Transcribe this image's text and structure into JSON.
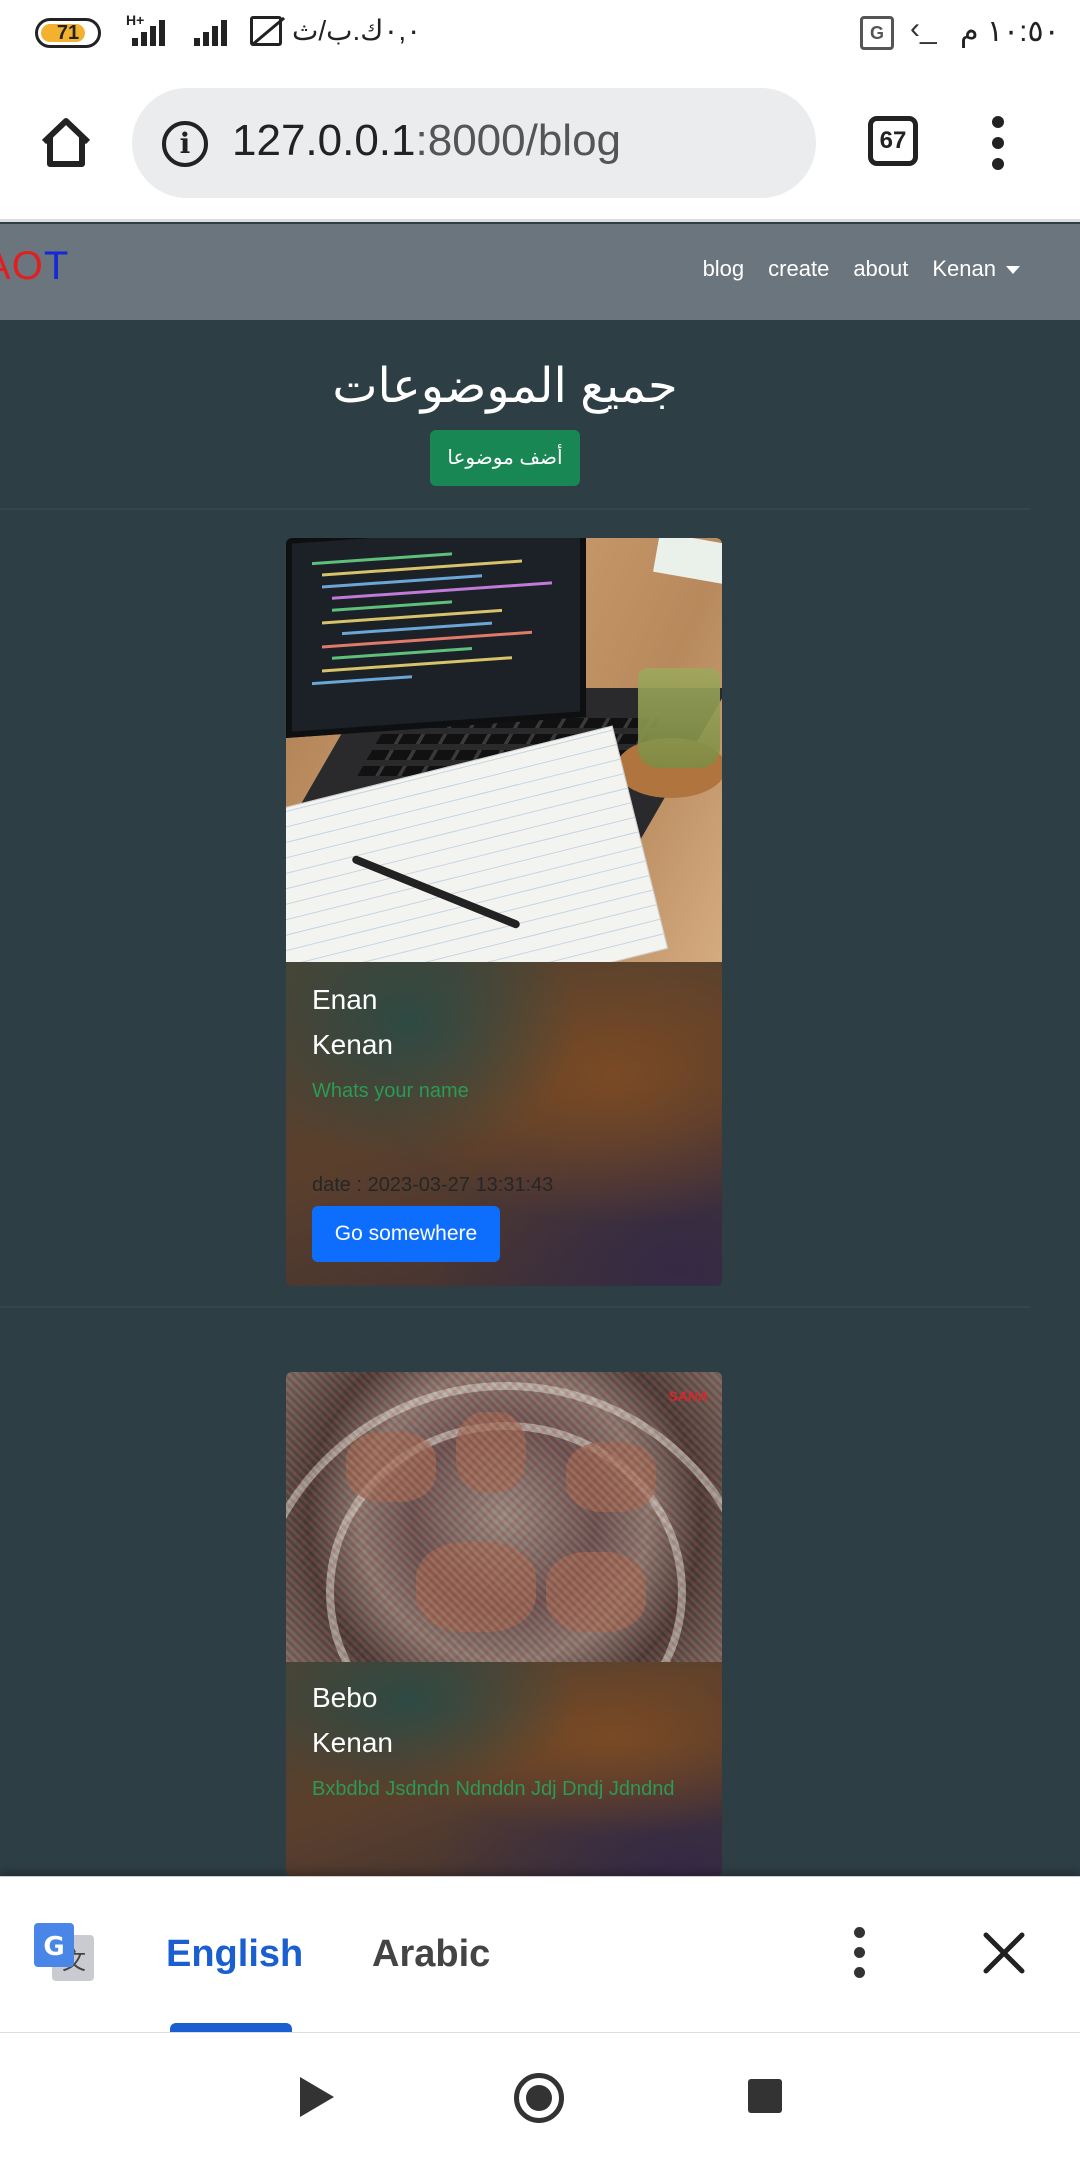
{
  "status_bar": {
    "battery": "71",
    "network_type": "H+",
    "speed": "٠,٠ك.ب/ث",
    "time": "١٠:٥٠ م"
  },
  "browser": {
    "url_host": "127.0.0.1",
    "url_path": ":8000/blog",
    "tab_count": "67"
  },
  "navbar": {
    "brand_part1": "A",
    "brand_part2": "O",
    "brand_part3": "T",
    "links": [
      "blog",
      "create",
      "about"
    ],
    "user": "Kenan"
  },
  "main": {
    "title": "جميع الموضوعات",
    "add_button": "أضف موضوعا"
  },
  "posts": [
    {
      "title": "Enan",
      "author": "Kenan",
      "text": "Whats your name",
      "date": "date : 2023-03-27 13:31:43",
      "button": "Go somewhere"
    },
    {
      "title": "Bebo",
      "author": "Kenan",
      "text": "Bxbdbd Jsdndn Ndnddn Jdj Dndj Jdndnd",
      "watermark": "SANA"
    }
  ],
  "translate_bar": {
    "source_lang": "English",
    "target_lang": "Arabic"
  },
  "colors": {
    "page_bg": "#2e3e45",
    "navbar_bg": "#6b757e",
    "add_button": "#198754",
    "primary_button": "#0d6efd",
    "card_text": "#2a9a55",
    "translate_accent": "#1a5fd0"
  }
}
